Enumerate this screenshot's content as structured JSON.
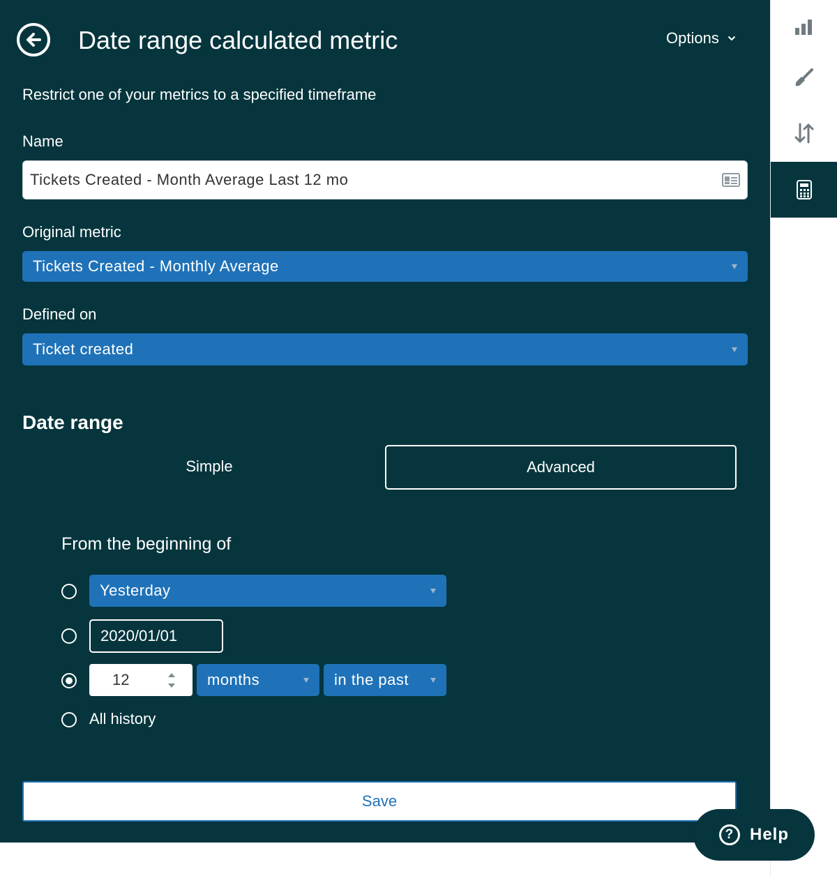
{
  "header": {
    "title": "Date range calculated metric",
    "options_label": "Options"
  },
  "subtitle": "Restrict one of your metrics to a specified timeframe",
  "name_field": {
    "label": "Name",
    "value": "Tickets Created - Month Average Last 12 mo"
  },
  "original_metric": {
    "label": "Original metric",
    "value": "Tickets Created - Monthly Average"
  },
  "defined_on": {
    "label": "Defined on",
    "value": "Ticket created"
  },
  "date_range": {
    "title": "Date range",
    "tabs": [
      {
        "label": "Simple",
        "active": false
      },
      {
        "label": "Advanced",
        "active": true
      }
    ],
    "from_label": "From the beginning of",
    "options": {
      "relative_select": "Yesterday",
      "date_value": "2020/01/01",
      "amount": "12",
      "unit": "months",
      "direction": "in the past",
      "all_history": "All history"
    },
    "selected_option": "amount"
  },
  "save_label": "Save",
  "help_label": "Help",
  "rail": [
    "bar-chart-icon",
    "paintbrush-icon",
    "sort-arrows-icon",
    "calculator-icon"
  ],
  "colors": {
    "panel_bg": "#06353d",
    "select_blue": "#1f72b8",
    "white": "#ffffff"
  }
}
